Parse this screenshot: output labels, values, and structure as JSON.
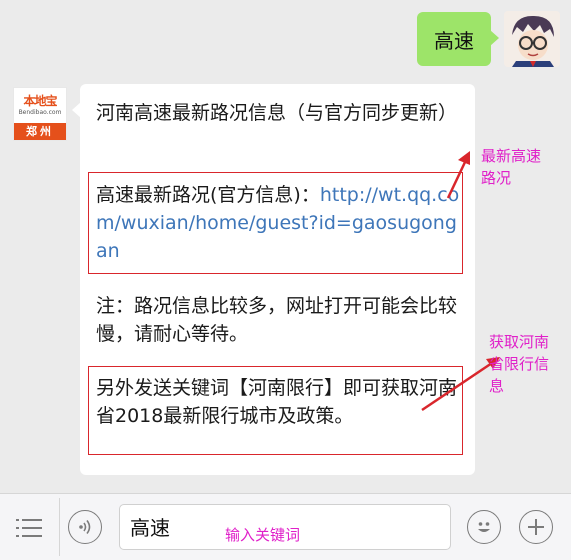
{
  "user_message": {
    "text": "高速"
  },
  "bot_avatar": {
    "logo_text": "本地宝",
    "logo_sub": "Bendibao.com",
    "city": "郑州"
  },
  "bot_message": {
    "title": "河南高速最新路况信息（与官方同步更新）",
    "info_label": "高速最新路况(官方信息)：",
    "info_link": "http://wt.qq.com/wuxian/home/guest?id=gaosugongan",
    "note": "注：路况信息比较多，网址打开可能会比较慢，请耐心等待。",
    "extra": "另外发送关键词【河南限行】即可获取河南省2018最新限行城市及政策。"
  },
  "annotations": {
    "latest_road": "最新高速\n路况",
    "henan_limit": "获取河南\n省限行信\n息",
    "input_keyword": "输入关键词"
  },
  "input_bar": {
    "value": "高速",
    "menu_icon": "menu-icon",
    "voice_icon": "voice-icon",
    "emoji_icon": "emoji-icon",
    "add_icon": "add-icon"
  },
  "colors": {
    "user_bubble": "#9de469",
    "link": "#3e76b9",
    "annotation": "#e020c9",
    "red_box": "#d9262c",
    "logo_orange": "#e5501b"
  }
}
